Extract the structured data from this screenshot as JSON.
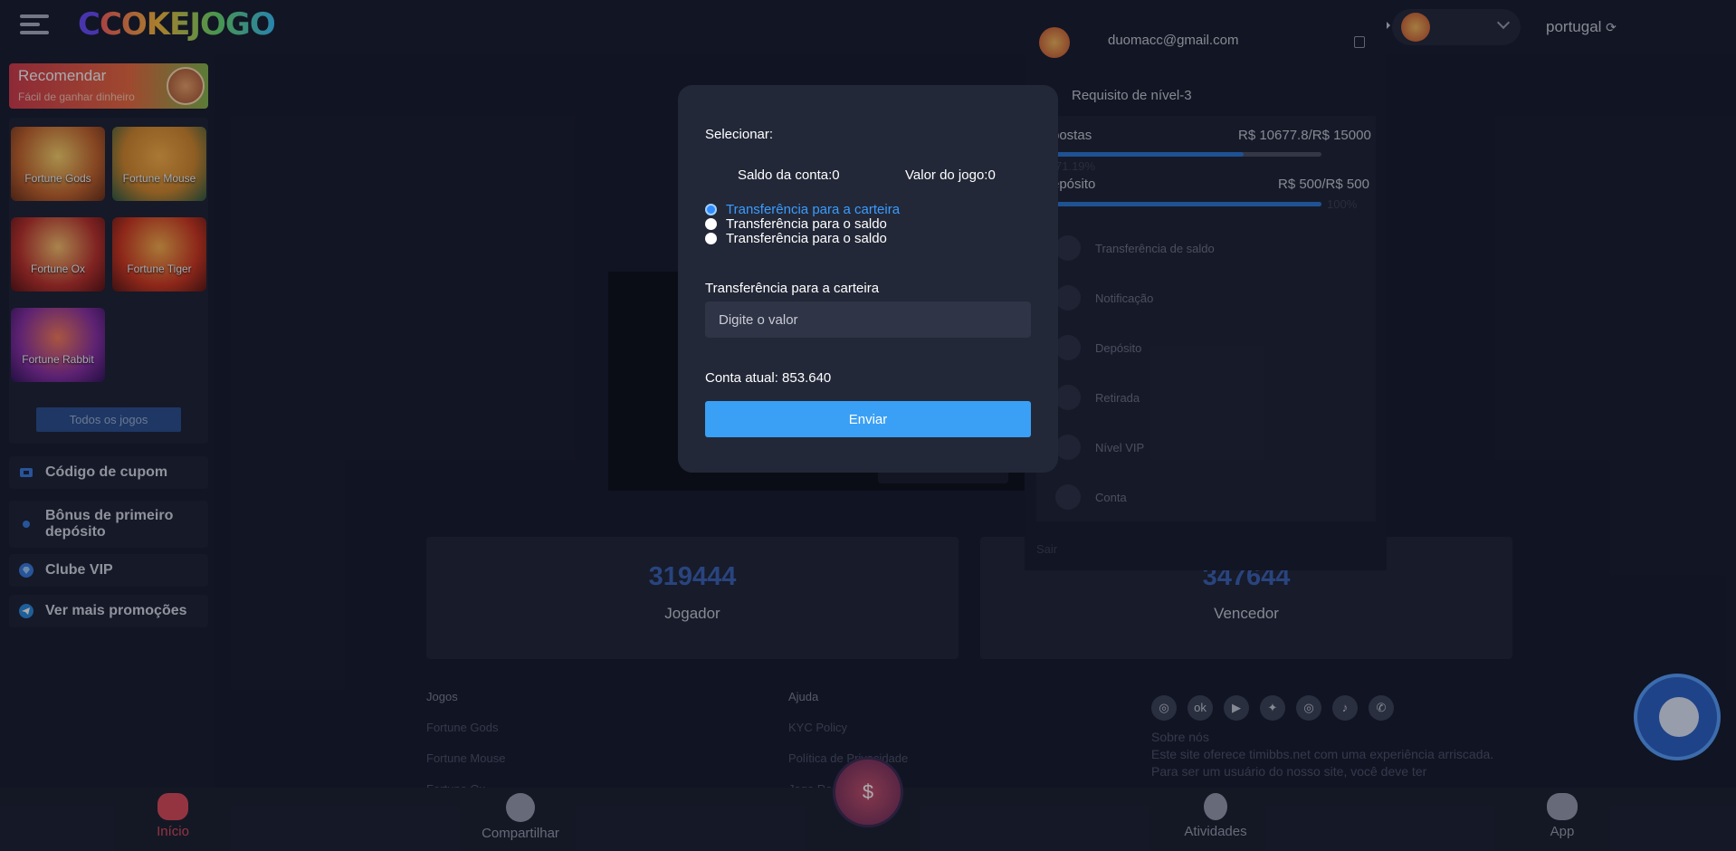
{
  "header": {
    "logo_c": "C",
    "logo_rest": "COKEJOGO",
    "language": "portugal",
    "refresh_icon": "refresh-icon"
  },
  "sidebar": {
    "promo": {
      "title": "Recomendar",
      "subtitle": "Fácil de ganhar dinheiro"
    },
    "games": [
      "Fortune Gods",
      "Fortune Mouse",
      "Fortune Ox",
      "Fortune Tiger",
      "Fortune Rabbit"
    ],
    "all_games": "Todos os jogos",
    "items": [
      {
        "label": "Código de cupom",
        "icon": "coupon-icon"
      },
      {
        "label": "Bônus de primeiro depósito",
        "icon": "bonus-icon"
      },
      {
        "label": "Clube VIP",
        "icon": "vip-icon"
      },
      {
        "label": "Ver mais promoções",
        "icon": "telegram-icon"
      }
    ]
  },
  "stats": [
    {
      "value": "319444",
      "label": "Jogador"
    },
    {
      "value": "347644",
      "label": "Vencedor"
    }
  ],
  "footer": {
    "col1": {
      "header": "Jogos",
      "links": [
        "Fortune Gods",
        "Fortune Mouse",
        "Fortune Ox"
      ]
    },
    "col2": {
      "header": "Ajuda",
      "links": [
        "KYC Policy",
        "Política de Privacidade",
        "Jogo Re"
      ]
    },
    "about_title": "Sobre nós",
    "about_text": "Este site oferece timibbs.net com uma experiência arriscada. Para ser um usuário do nosso site, você deve ter"
  },
  "bottom_nav": [
    {
      "label": "Início",
      "icon": "gamepad-icon"
    },
    {
      "label": "Compartilhar",
      "icon": "share-icon"
    },
    {
      "label": "Atividades",
      "icon": "medal-icon"
    },
    {
      "label": "App",
      "icon": "download-icon"
    }
  ],
  "panel": {
    "email": "duomacc@gmail.com",
    "level_req": "Requisito de nível-3",
    "apostas_label": "postas",
    "apostas_value": "R$ 10677.8/R$ 15000",
    "apostas_pct": "71.19%",
    "apostas_progress": 0.7119,
    "deposito_label": "epósito",
    "deposito_value": "R$ 500/R$ 500",
    "deposito_pct": "100%",
    "deposito_progress": 1.0,
    "menu": [
      "Transferência de saldo",
      "Notificação",
      "Depósito",
      "Retirada",
      "Nível VIP",
      "Conta"
    ],
    "sair": "Sair"
  },
  "modal": {
    "select_label": "Selecionar:",
    "saldo": "Saldo da conta:0",
    "valor": "Valor do jogo:0",
    "options": [
      "Transferência para a carteira",
      "Transferência para o saldo",
      "Transferência para o saldo"
    ],
    "selected_option": 0,
    "transfer_label": "Transferência para a carteira",
    "input_placeholder": "Digite o valor",
    "conta_atual": "Conta atual: 853.640",
    "submit": "Enviar"
  },
  "colors": {
    "accent": "#3aa0f5",
    "background": "#161a2b",
    "modal": "#232838",
    "stat_number": "#3b63b7"
  }
}
